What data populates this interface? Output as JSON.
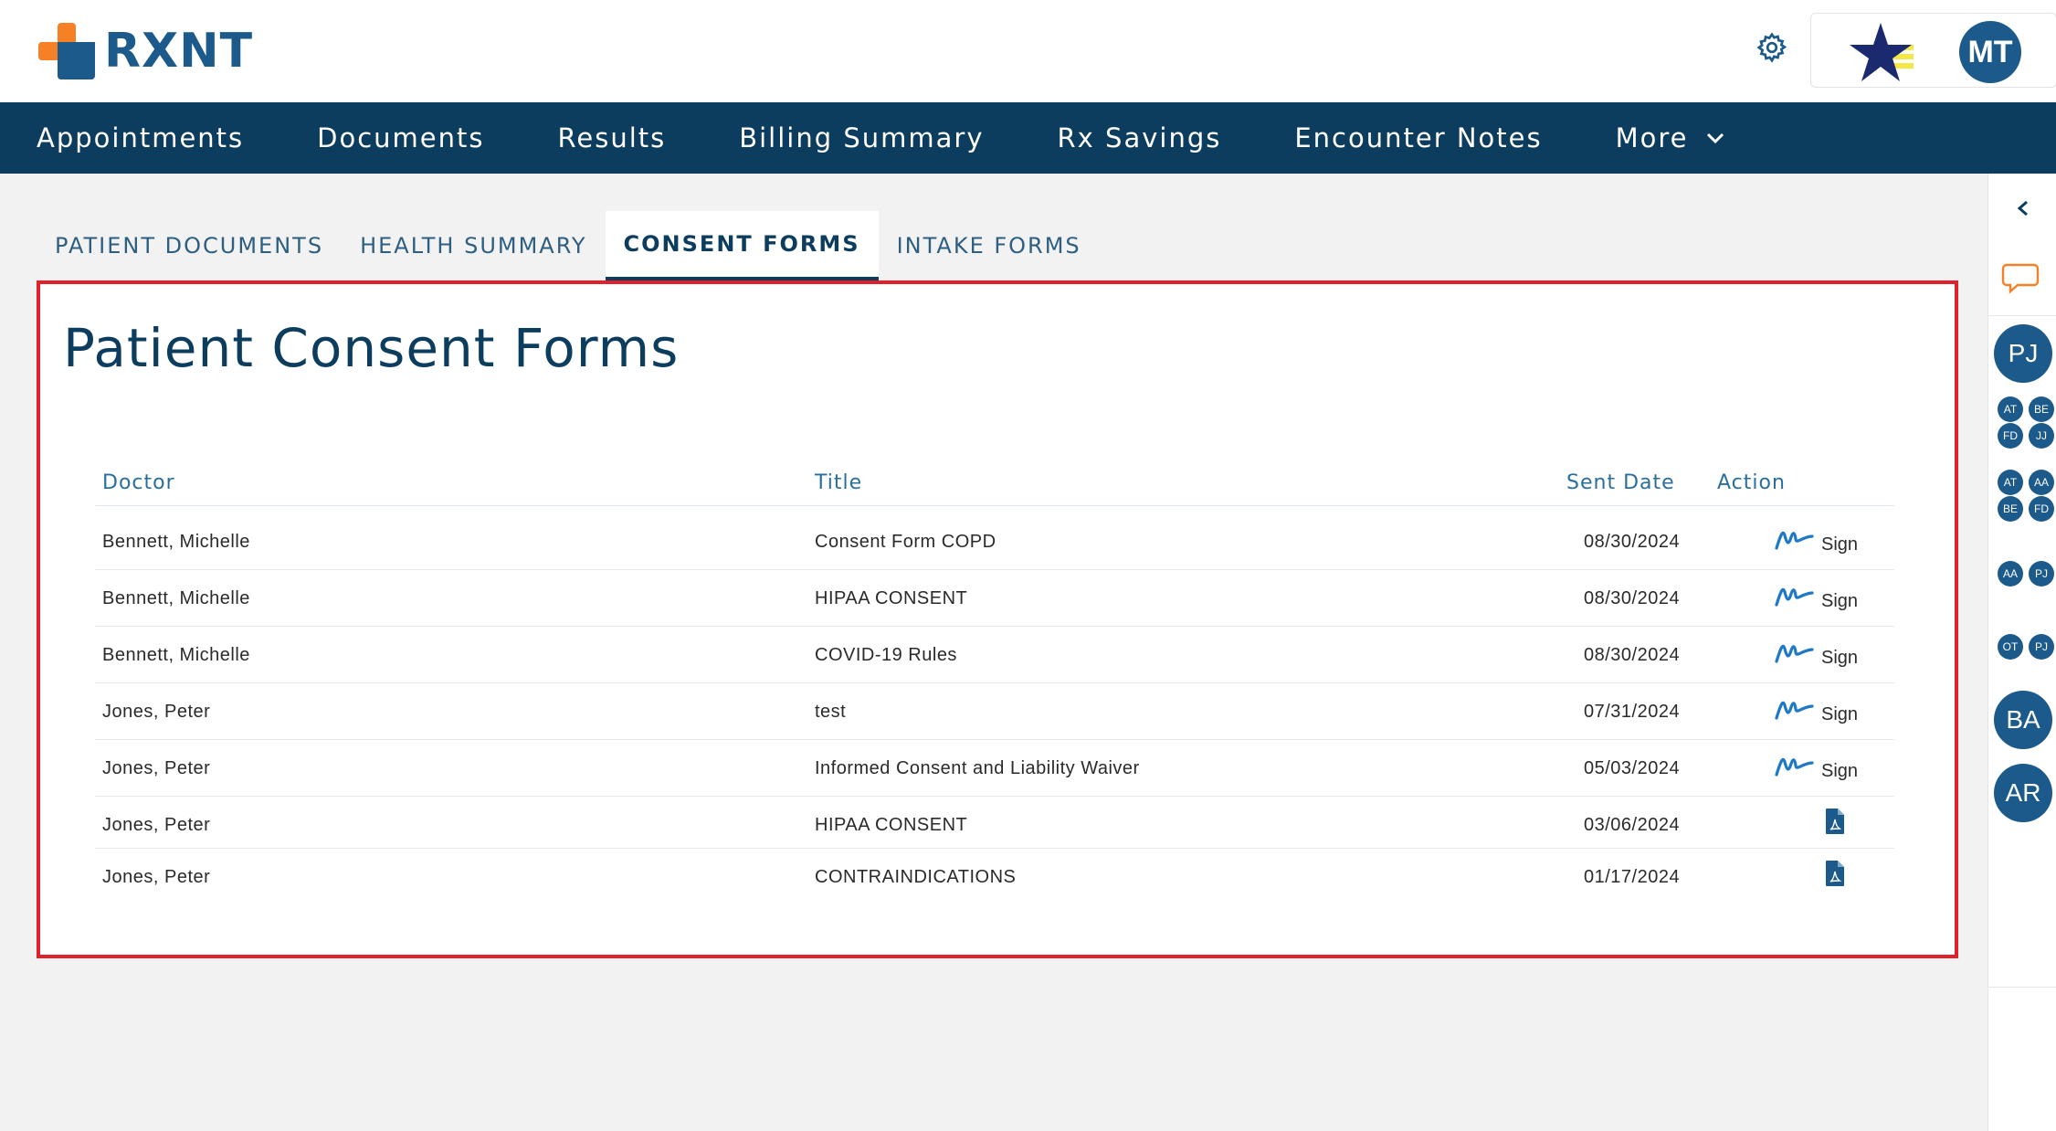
{
  "header": {
    "logo_text": "RXNT",
    "user_initials": "MT"
  },
  "nav": {
    "items": [
      "Appointments",
      "Documents",
      "Results",
      "Billing Summary",
      "Rx Savings",
      "Encounter Notes",
      "More"
    ]
  },
  "tabs": {
    "items": [
      "PATIENT DOCUMENTS",
      "HEALTH SUMMARY",
      "CONSENT FORMS",
      "INTAKE FORMS"
    ],
    "active": "CONSENT FORMS"
  },
  "main": {
    "title": "Patient Consent Forms",
    "columns": [
      "Doctor",
      "Title",
      "Sent Date",
      "Action"
    ],
    "rows": [
      {
        "doctor": "Bennett, Michelle",
        "title": "Consent Form COPD",
        "sent_date": "08/30/2024",
        "action": "Sign"
      },
      {
        "doctor": "Bennett, Michelle",
        "title": "HIPAA CONSENT",
        "sent_date": "08/30/2024",
        "action": "Sign"
      },
      {
        "doctor": "Bennett, Michelle",
        "title": "COVID-19 Rules",
        "sent_date": "08/30/2024",
        "action": "Sign"
      },
      {
        "doctor": "Jones, Peter",
        "title": "test",
        "sent_date": "07/31/2024",
        "action": "Sign"
      },
      {
        "doctor": "Jones, Peter",
        "title": "Informed Consent and Liability Waiver",
        "sent_date": "05/03/2024",
        "action": "Sign"
      },
      {
        "doctor": "Jones, Peter",
        "title": "HIPAA CONSENT",
        "sent_date": "03/06/2024",
        "action": "pdf"
      },
      {
        "doctor": "Jones, Peter",
        "title": "CONTRAINDICATIONS",
        "sent_date": "01/17/2024",
        "action": "pdf"
      }
    ]
  },
  "sidebar": {
    "avatar_main": "PJ",
    "group1": [
      "AT",
      "BE",
      "FD",
      "JJ"
    ],
    "group2": [
      "AT",
      "AA",
      "BE",
      "FD"
    ],
    "pair1": [
      "AA",
      "PJ"
    ],
    "pair2": [
      "OT",
      "PJ"
    ],
    "avatar_ba": "BA",
    "avatar_ar": "AR"
  },
  "colors": {
    "brand_blue": "#1b5a8a",
    "nav_bg": "#0d3d5e",
    "logo_orange": "#f58025",
    "highlight_red": "#e0202a",
    "sign_blue": "#1e78c8"
  },
  "icons": {
    "settings": "gear-icon",
    "more": "chevron-down-icon",
    "collapse": "chevron-left-icon",
    "chat": "chat-icon",
    "sign": "signature-icon",
    "pdf": "pdf-icon"
  }
}
